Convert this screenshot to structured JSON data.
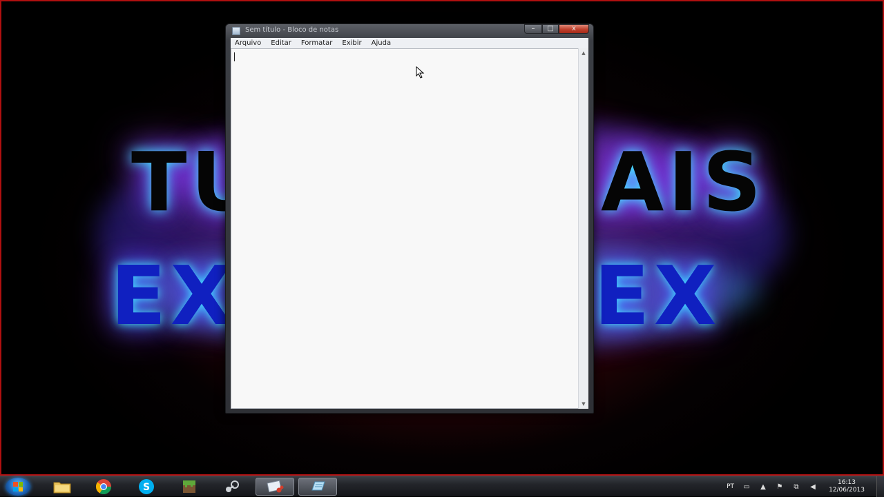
{
  "window": {
    "title": "Sem título - Bloco de notas",
    "caption": {
      "minimize": "–",
      "maximize": "□",
      "close": "x"
    }
  },
  "menubar": {
    "items": [
      {
        "label": "Arquivo"
      },
      {
        "label": "Editar"
      },
      {
        "label": "Formatar"
      },
      {
        "label": "Exibir"
      },
      {
        "label": "Ajuda"
      }
    ]
  },
  "editor": {
    "value": ""
  },
  "wallpaper": {
    "line1_left": "TU",
    "line1_right": "AIS",
    "line2_left": "EX",
    "line2_right": "EX"
  },
  "taskbar": {
    "apps": [
      {
        "name": "windows-explorer",
        "icon": "folder-icon",
        "active": false
      },
      {
        "name": "google-chrome",
        "icon": "chrome-icon",
        "active": false
      },
      {
        "name": "skype",
        "icon": "skype-icon",
        "active": false
      },
      {
        "name": "minecraft",
        "icon": "grass-block-icon",
        "active": false
      },
      {
        "name": "steam",
        "icon": "steam-icon",
        "active": false
      },
      {
        "name": "snipping-tool",
        "icon": "snipping-tool-icon",
        "active": false
      },
      {
        "name": "notepad",
        "icon": "notepad-icon",
        "active": true
      }
    ]
  },
  "tray": {
    "language": "PT",
    "time": "16:13",
    "date": "12/06/2013"
  },
  "colors": {
    "accent_blue": "#1020c0",
    "close_red": "#c0402c",
    "wallpaper_red": "#5a0810"
  }
}
